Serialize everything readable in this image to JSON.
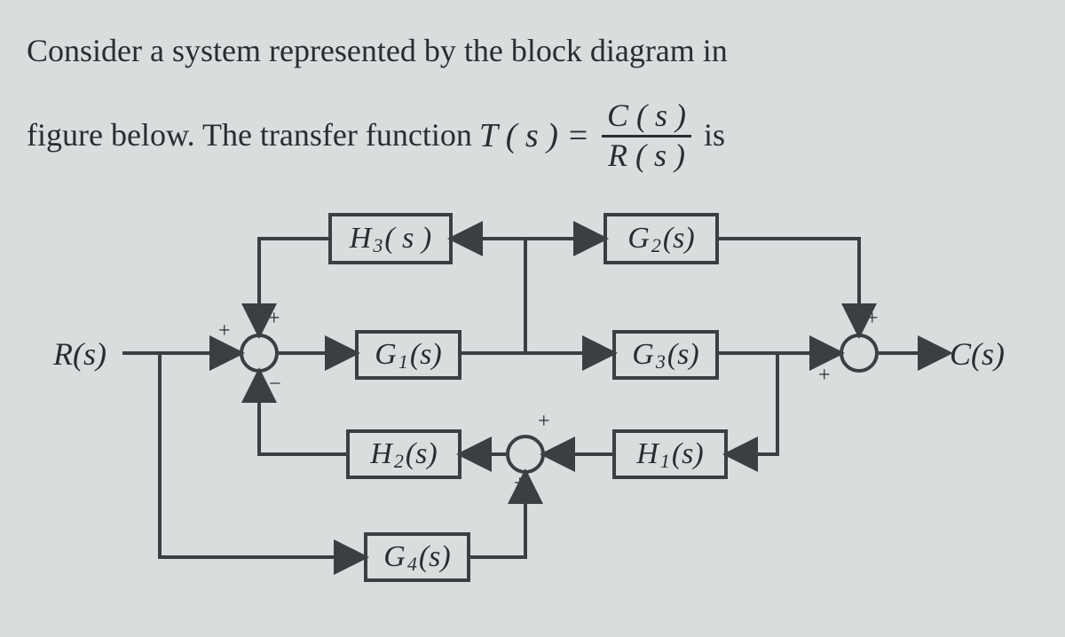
{
  "prompt": {
    "line1": "Consider a system represented by the block diagram in",
    "line2_pre": "figure below. The transfer function",
    "eq_lhs": "T ( s ) =",
    "frac_num": "C ( s )",
    "frac_den": "R ( s )",
    "line2_post": "is"
  },
  "signals": {
    "input": "R(s)",
    "output": "C(s)"
  },
  "blocks": {
    "H3": "H",
    "H3_sub": "3",
    "H3_arg": "( s )",
    "G2": "G",
    "G2_sub": "2",
    "G2_arg": "(s)",
    "G1": "G",
    "G1_sub": "1",
    "G1_arg": "(s)",
    "G3": "G",
    "G3_sub": "3",
    "G3_arg": "(s)",
    "H2": "H",
    "H2_sub": "2",
    "H2_arg": "(s)",
    "H1": "H",
    "H1_sub": "1",
    "H1_arg": "(s)",
    "G4": "G",
    "G4_sub": "4",
    "G4_arg": "(s)"
  },
  "signs": {
    "sum1_top": "+",
    "sum1_left": "+",
    "sum1_bottom": "−",
    "sum2_top": "+",
    "sum2_bottom": "+",
    "sum3_top": "+",
    "sum3_left": "+"
  }
}
